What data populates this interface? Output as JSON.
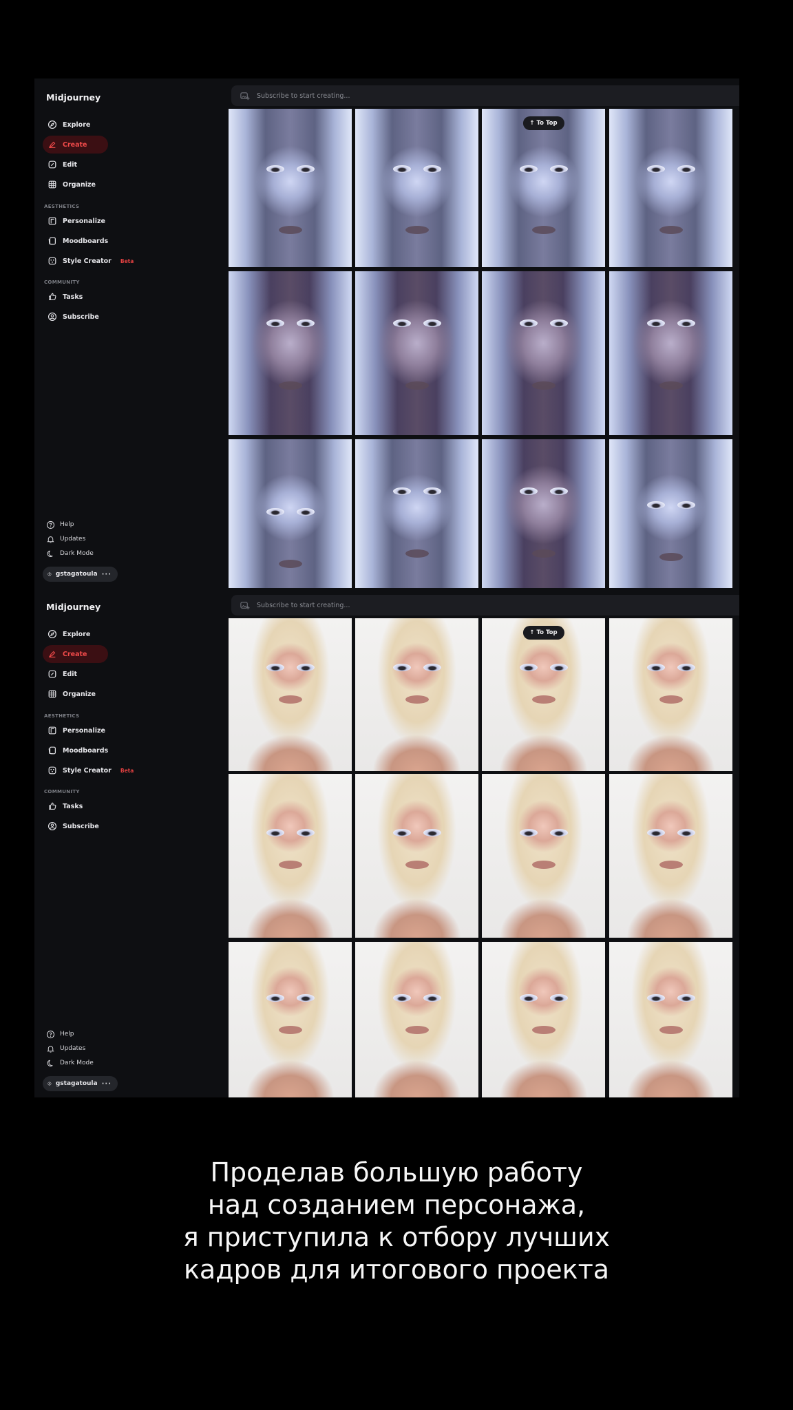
{
  "panels": [
    {
      "app_title": "Midjourney",
      "nav": {
        "explore": "Explore",
        "create": "Create",
        "edit": "Edit",
        "organize": "Organize",
        "aesthetics_label": "AESTHETICS",
        "personalize": "Personalize",
        "moodboards": "Moodboards",
        "style_creator": "Style Creator",
        "style_creator_badge": "Beta",
        "community_label": "COMMUNITY",
        "tasks": "Tasks",
        "subscribe": "Subscribe"
      },
      "footer": {
        "help": "Help",
        "updates": "Updates",
        "dark_mode": "Dark Mode",
        "username": "gstagatoula",
        "more": "···"
      },
      "prompt_placeholder": "Subscribe to start creating...",
      "to_top": "To Top",
      "image_style": "silver-platinum portrait",
      "image_count": 12
    },
    {
      "app_title": "Midjourney",
      "nav": {
        "explore": "Explore",
        "create": "Create",
        "edit": "Edit",
        "organize": "Organize",
        "aesthetics_label": "AESTHETICS",
        "personalize": "Personalize",
        "moodboards": "Moodboards",
        "style_creator": "Style Creator",
        "style_creator_badge": "Beta",
        "community_label": "COMMUNITY",
        "tasks": "Tasks",
        "subscribe": "Subscribe"
      },
      "footer": {
        "help": "Help",
        "updates": "Updates",
        "dark_mode": "Dark Mode",
        "username": "gstagatoula",
        "more": "···"
      },
      "prompt_placeholder": "Subscribe to start creating...",
      "to_top": "To Top",
      "image_style": "blonde studio portrait",
      "image_count": 12
    }
  ],
  "caption": {
    "line1": "Проделав большую работу",
    "line2": "над созданием персонажа,",
    "line3": "я приступила к отбору лучших",
    "line4": "кадров для итогового проекта"
  },
  "colors": {
    "accent_red": "#f04a4a",
    "active_bg": "#3b0f13",
    "panel_bg": "#0e0f12"
  }
}
